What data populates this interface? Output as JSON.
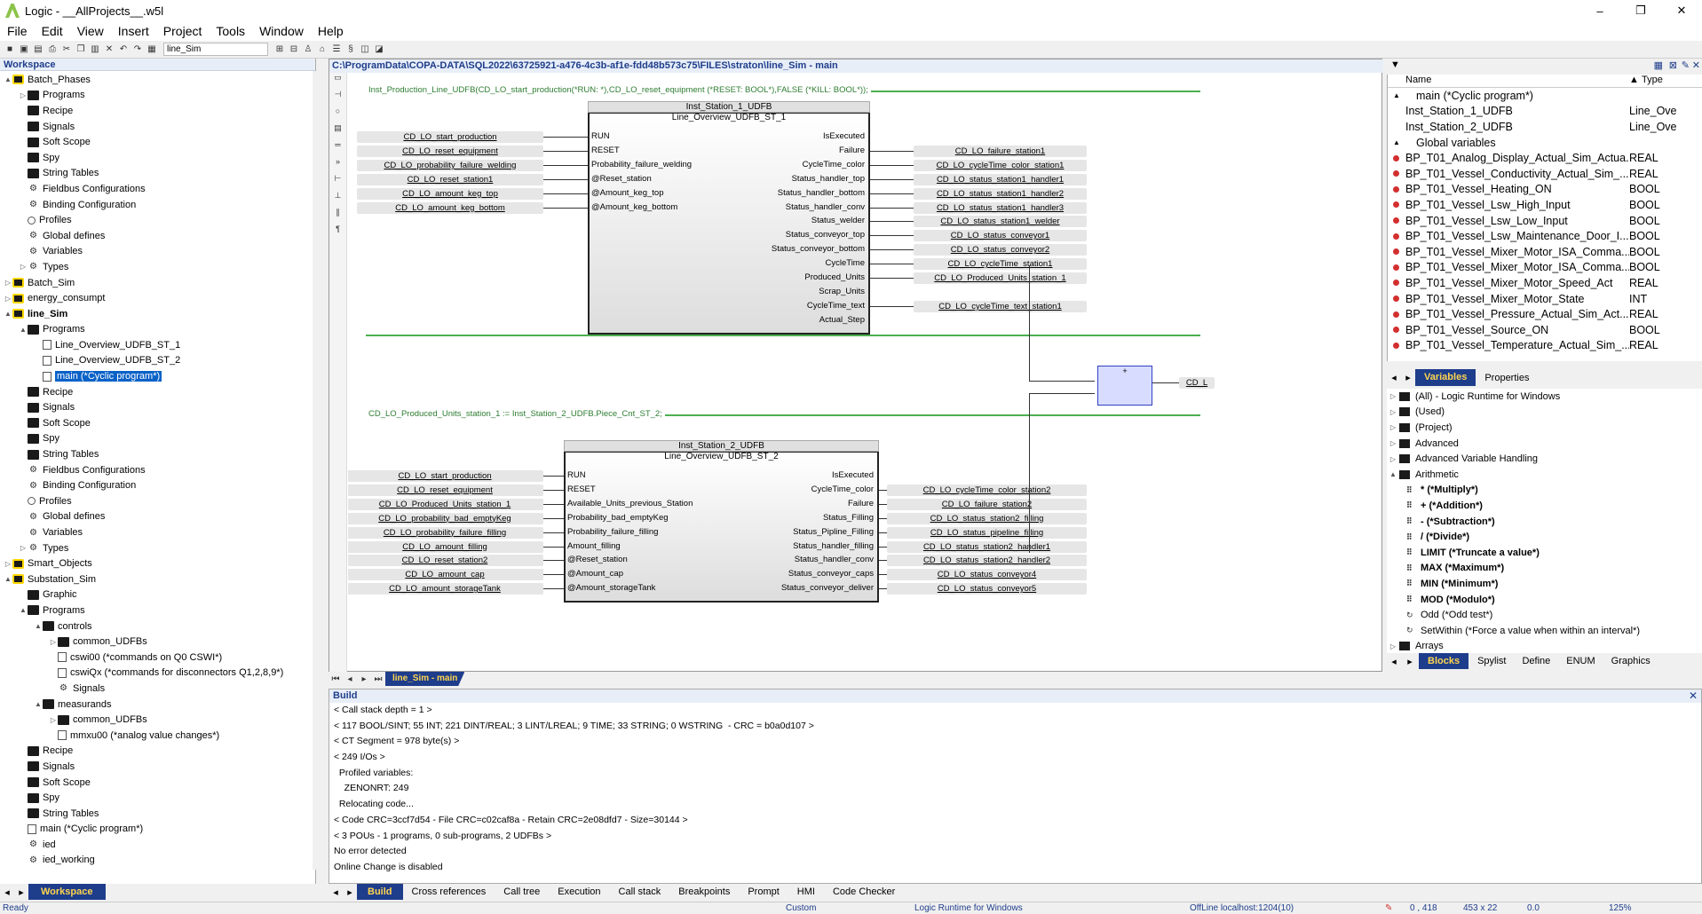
{
  "window": {
    "title": "Logic - __AllProjects__.w5l",
    "min": "–",
    "max": "❐",
    "close": "✕"
  },
  "menu": [
    "File",
    "Edit",
    "View",
    "Insert",
    "Project",
    "Tools",
    "Window",
    "Help"
  ],
  "toolbar": {
    "program_select": "line_Sim"
  },
  "workspace": {
    "title": "Workspace",
    "tab": "Workspace",
    "tree": [
      {
        "label": "Batch_Phases",
        "level": 0,
        "toggle": "▲",
        "icon": "proj"
      },
      {
        "label": "Programs",
        "level": 1,
        "toggle": "▷",
        "icon": "folder"
      },
      {
        "label": "Recipe",
        "level": 1,
        "toggle": "",
        "icon": "folder"
      },
      {
        "label": "Signals",
        "level": 1,
        "toggle": "",
        "icon": "folder"
      },
      {
        "label": "Soft Scope",
        "level": 1,
        "toggle": "",
        "icon": "folder"
      },
      {
        "label": "Spy",
        "level": 1,
        "toggle": "",
        "icon": "folder"
      },
      {
        "label": "String Tables",
        "level": 1,
        "toggle": "",
        "icon": "folder"
      },
      {
        "label": "Fieldbus Configurations",
        "level": 1,
        "toggle": "",
        "icon": "gear"
      },
      {
        "label": "Binding Configuration",
        "level": 1,
        "toggle": "",
        "icon": "gear"
      },
      {
        "label": "Profiles",
        "level": 1,
        "toggle": "",
        "icon": "pers"
      },
      {
        "label": "Global defines",
        "level": 1,
        "toggle": "",
        "icon": "gear"
      },
      {
        "label": "Variables",
        "level": 1,
        "toggle": "",
        "icon": "gear"
      },
      {
        "label": "Types",
        "level": 1,
        "toggle": "▷",
        "icon": "gear"
      },
      {
        "label": "Batch_Sim",
        "level": 0,
        "toggle": "▷",
        "icon": "proj"
      },
      {
        "label": "energy_consumpt",
        "level": 0,
        "toggle": "▷",
        "icon": "proj"
      },
      {
        "label": "line_Sim",
        "level": 0,
        "toggle": "▲",
        "icon": "proj",
        "bold": true
      },
      {
        "label": "Programs",
        "level": 1,
        "toggle": "▲",
        "icon": "folder"
      },
      {
        "label": "Line_Overview_UDFB_ST_1",
        "level": 2,
        "toggle": "",
        "icon": "doc"
      },
      {
        "label": "Line_Overview_UDFB_ST_2",
        "level": 2,
        "toggle": "",
        "icon": "doc"
      },
      {
        "label": "main (*Cyclic program*)",
        "level": 2,
        "toggle": "",
        "icon": "doc",
        "selected": true
      },
      {
        "label": "Recipe",
        "level": 1,
        "toggle": "",
        "icon": "folder"
      },
      {
        "label": "Signals",
        "level": 1,
        "toggle": "",
        "icon": "folder"
      },
      {
        "label": "Soft Scope",
        "level": 1,
        "toggle": "",
        "icon": "folder"
      },
      {
        "label": "Spy",
        "level": 1,
        "toggle": "",
        "icon": "folder"
      },
      {
        "label": "String Tables",
        "level": 1,
        "toggle": "",
        "icon": "folder"
      },
      {
        "label": "Fieldbus Configurations",
        "level": 1,
        "toggle": "",
        "icon": "gear"
      },
      {
        "label": "Binding Configuration",
        "level": 1,
        "toggle": "",
        "icon": "gear"
      },
      {
        "label": "Profiles",
        "level": 1,
        "toggle": "",
        "icon": "pers"
      },
      {
        "label": "Global defines",
        "level": 1,
        "toggle": "",
        "icon": "gear"
      },
      {
        "label": "Variables",
        "level": 1,
        "toggle": "",
        "icon": "gear"
      },
      {
        "label": "Types",
        "level": 1,
        "toggle": "▷",
        "icon": "gear"
      },
      {
        "label": "Smart_Objects",
        "level": 0,
        "toggle": "▷",
        "icon": "proj"
      },
      {
        "label": "Substation_Sim",
        "level": 0,
        "toggle": "▲",
        "icon": "proj"
      },
      {
        "label": "Graphic",
        "level": 1,
        "toggle": "",
        "icon": "folder"
      },
      {
        "label": "Programs",
        "level": 1,
        "toggle": "▲",
        "icon": "folder"
      },
      {
        "label": "controls",
        "level": 2,
        "toggle": "▲",
        "icon": "folder"
      },
      {
        "label": "common_UDFBs",
        "level": 3,
        "toggle": "▷",
        "icon": "folder"
      },
      {
        "label": "cswi00 (*commands on Q0 CSWI*)",
        "level": 3,
        "toggle": "",
        "icon": "doc"
      },
      {
        "label": "cswiQx (*commands for disconnectors Q1,2,8,9*)",
        "level": 3,
        "toggle": "",
        "icon": "doc"
      },
      {
        "label": "Signals",
        "level": 3,
        "toggle": "",
        "icon": "gear"
      },
      {
        "label": "measurands",
        "level": 2,
        "toggle": "▲",
        "icon": "folder"
      },
      {
        "label": "common_UDFBs",
        "level": 3,
        "toggle": "▷",
        "icon": "folder"
      },
      {
        "label": "mmxu00 (*analog value changes*)",
        "level": 3,
        "toggle": "",
        "icon": "doc"
      },
      {
        "label": "Recipe",
        "level": 1,
        "toggle": "",
        "icon": "folder"
      },
      {
        "label": "Signals",
        "level": 1,
        "toggle": "",
        "icon": "folder"
      },
      {
        "label": "Soft Scope",
        "level": 1,
        "toggle": "",
        "icon": "folder"
      },
      {
        "label": "Spy",
        "level": 1,
        "toggle": "",
        "icon": "folder"
      },
      {
        "label": "String Tables",
        "level": 1,
        "toggle": "",
        "icon": "folder"
      },
      {
        "label": "main (*Cyclic program*)",
        "level": 1,
        "toggle": "",
        "icon": "doc"
      },
      {
        "label": "ied",
        "level": 1,
        "toggle": "",
        "icon": "gear"
      },
      {
        "label": "ied_working",
        "level": 1,
        "toggle": "",
        "icon": "gear"
      },
      {
        "label": "Fieldbus Configurations",
        "level": 1,
        "toggle": "",
        "icon": "gear"
      }
    ]
  },
  "editor": {
    "path": "C:\\ProgramData\\COPA-DATA\\SQL2022\\63725921-a476-4c3b-af1e-fdd48b573c75\\FILES\\straton\\line_Sim - main",
    "tab": "line_Sim - main",
    "rung1": "Inst_Production_Line_UDFB(CD_LO_start_production(*RUN: *),CD_LO_reset_equipment (*RESET: BOOL*),FALSE (*KILL: BOOL*));",
    "rung3": "CD_LO_Produced_Units_station_1  := Inst_Station_2_UDFB.Piece_Cnt_ST_2;",
    "fb1": {
      "inst": "Inst_Station_1_UDFB",
      "type": "Line_Overview_UDFB_ST_1",
      "in_pins": [
        "RUN",
        "RESET",
        "Probability_failure_welding",
        "@Reset_station",
        "@Amount_keg_top",
        "@Amount_keg_bottom"
      ],
      "out_pins": [
        "IsExecuted",
        "Failure",
        "CycleTime_color",
        "Status_handler_top",
        "Status_handler_bottom",
        "Status_handler_conv",
        "Status_welder",
        "Status_conveyor_top",
        "Status_conveyor_bottom",
        "CycleTime",
        "Produced_Units",
        "Scrap_Units",
        "CycleTime_text",
        "Actual_Step"
      ],
      "in_vars": [
        "CD_LO_start_production",
        "CD_LO_reset_equipment",
        "CD_LO_probability_failure_welding",
        "CD_LO_reset_station1",
        "CD_LO_amount_keg_top",
        "CD_LO_amount_keg_bottom"
      ],
      "out_vars": [
        "",
        "CD_LO_failure_station1",
        "CD_LO_cycleTime_color_station1",
        "CD_LO_status_station1_handler1",
        "CD_LO_status_station1_handler2",
        "CD_LO_status_station1_handler3",
        "CD_LO_status_station1_welder",
        "CD_LO_status_conveyor1",
        "CD_LO_status_conveyor2",
        "CD_LO_cycleTime_station1",
        "CD_LO_Produced_Units_station_1",
        "",
        "CD_LO_cycleTime_text_station1",
        ""
      ]
    },
    "fb2": {
      "inst": "Inst_Station_2_UDFB",
      "type": "Line_Overview_UDFB_ST_2",
      "in_pins": [
        "RUN",
        "RESET",
        "Available_Units_previous_Station",
        "Probability_bad_emptyKeg",
        "Probability_failure_filling",
        "Amount_filling",
        "@Reset_station",
        "@Amount_cap",
        "@Amount_storageTank"
      ],
      "out_pins": [
        "IsExecuted",
        "CycleTime_color",
        "Failure",
        "Status_Filling",
        "Status_Pipline_Filling",
        "Status_handler_filling",
        "Status_handler_conv",
        "Status_conveyor_caps",
        "Status_conveyor_deliver"
      ],
      "in_vars": [
        "CD_LO_start_production",
        "CD_LO_reset_equipment",
        "CD_LO_Produced_Units_station_1",
        "CD_LO_probability_bad_emptyKeg",
        "CD_LO_probability_failure_filling",
        "CD_LO_amount_filling",
        "CD_LO_reset_station2",
        "CD_LO_amount_cap",
        "CD_LO_amount_storageTank"
      ],
      "out_vars": [
        "",
        "CD_LO_cycleTime_color_station2",
        "CD_LO_failure_station2",
        "CD_LO_status_station2_filling",
        "CD_LO_status_pipeline_filling",
        "CD_LO_status_station2_handler1",
        "CD_LO_status_station2_handler2",
        "CD_LO_status_conveyor4",
        "CD_LO_status_conveyor5"
      ]
    },
    "addblock": "+",
    "addout": "CD_L"
  },
  "variables": {
    "col_name": "Name",
    "col_type": "Type",
    "sort": "▲",
    "rows": [
      {
        "name": "main (*Cyclic program*)",
        "type": "",
        "kind": "prog"
      },
      {
        "name": "Inst_Station_1_UDFB",
        "type": "Line_Ove",
        "kind": "inst"
      },
      {
        "name": "Inst_Station_2_UDFB",
        "type": "Line_Ove",
        "kind": "inst"
      },
      {
        "name": "Global variables",
        "type": "",
        "kind": "group"
      },
      {
        "name": "BP_T01_Analog_Display_Actual_Sim_Actua...",
        "type": "REAL",
        "kind": "var"
      },
      {
        "name": "BP_T01_Vessel_Conductivity_Actual_Sim_...",
        "type": "REAL",
        "kind": "var"
      },
      {
        "name": "BP_T01_Vessel_Heating_ON",
        "type": "BOOL",
        "kind": "var"
      },
      {
        "name": "BP_T01_Vessel_Lsw_High_Input",
        "type": "BOOL",
        "kind": "var"
      },
      {
        "name": "BP_T01_Vessel_Lsw_Low_Input",
        "type": "BOOL",
        "kind": "var"
      },
      {
        "name": "BP_T01_Vessel_Lsw_Maintenance_Door_I...",
        "type": "BOOL",
        "kind": "var"
      },
      {
        "name": "BP_T01_Vessel_Mixer_Motor_ISA_Comma...",
        "type": "BOOL",
        "kind": "var"
      },
      {
        "name": "BP_T01_Vessel_Mixer_Motor_ISA_Comma...",
        "type": "BOOL",
        "kind": "var"
      },
      {
        "name": "BP_T01_Vessel_Mixer_Motor_Speed_Act",
        "type": "REAL",
        "kind": "var"
      },
      {
        "name": "BP_T01_Vessel_Mixer_Motor_State",
        "type": "INT",
        "kind": "var"
      },
      {
        "name": "BP_T01_Vessel_Pressure_Actual_Sim_Act...",
        "type": "REAL",
        "kind": "var"
      },
      {
        "name": "BP_T01_Vessel_Source_ON",
        "type": "BOOL",
        "kind": "var"
      },
      {
        "name": "BP_T01_Vessel_Temperature_Actual_Sim_...",
        "type": "REAL",
        "kind": "var"
      }
    ],
    "tabs": [
      "Variables",
      "Properties"
    ]
  },
  "blocks": {
    "rows": [
      {
        "label": "(All) - Logic Runtime for Windows",
        "type": "cat"
      },
      {
        "label": "(Used)",
        "type": "cat"
      },
      {
        "label": "(Project)",
        "type": "cat"
      },
      {
        "label": "Advanced",
        "type": "cat"
      },
      {
        "label": "Advanced Variable Handling",
        "type": "cat"
      },
      {
        "label": "Arithmetic",
        "type": "open"
      },
      {
        "label": "* (*Multiply*)",
        "type": "b"
      },
      {
        "label": "+ (*Addition*)",
        "type": "b"
      },
      {
        "label": "- (*Subtraction*)",
        "type": "b"
      },
      {
        "label": "/ (*Divide*)",
        "type": "b"
      },
      {
        "label": "LIMIT (*Truncate a value*)",
        "type": "b"
      },
      {
        "label": "MAX (*Maximum*)",
        "type": "b"
      },
      {
        "label": "MIN (*Minimum*)",
        "type": "b"
      },
      {
        "label": "MOD (*Modulo*)",
        "type": "b"
      },
      {
        "label": "Odd (*Odd test*)",
        "type": "n"
      },
      {
        "label": "SetWithin (*Force a value when within an interval*)",
        "type": "n"
      },
      {
        "label": "Arrays",
        "type": "cat"
      }
    ],
    "tabs": [
      "Blocks",
      "Spylist",
      "Define",
      "ENUM",
      "Graphics"
    ]
  },
  "build": {
    "title": "Build",
    "lines": [
      "< Call stack depth = 1 >",
      "< 117 BOOL/SINT; 55 INT; 221 DINT/REAL; 3 LINT/LREAL; 9 TIME; 33 STRING; 0 WSTRING  - CRC = b0a0d107 >",
      "< CT Segment = 978 byte(s) >",
      "< 249 I/Os >",
      "  Profiled variables:",
      "    ZENONRT: 249",
      "  Relocating code...",
      "< Code CRC=3ccf7d54 - File CRC=c02caf8a - Retain CRC=2e08dfd7 - Size=30144 >",
      "< 3 POUs - 1 programs, 0 sub-programs, 2 UDFBs >",
      "No error detected",
      "Online Change is disabled"
    ],
    "tabs": [
      "Build",
      "Cross references",
      "Call tree",
      "Execution",
      "Call stack",
      "Breakpoints",
      "Prompt",
      "HMI",
      "Code Checker"
    ]
  },
  "status": {
    "ready": "Ready",
    "custom": "Custom",
    "runtime": "Logic Runtime for Windows",
    "offline": "OffLine  localhost:1204(10)",
    "coords": "0 , 418",
    "size": "453 x 22",
    "zoom_v": "0.0",
    "zoom": "125%"
  }
}
